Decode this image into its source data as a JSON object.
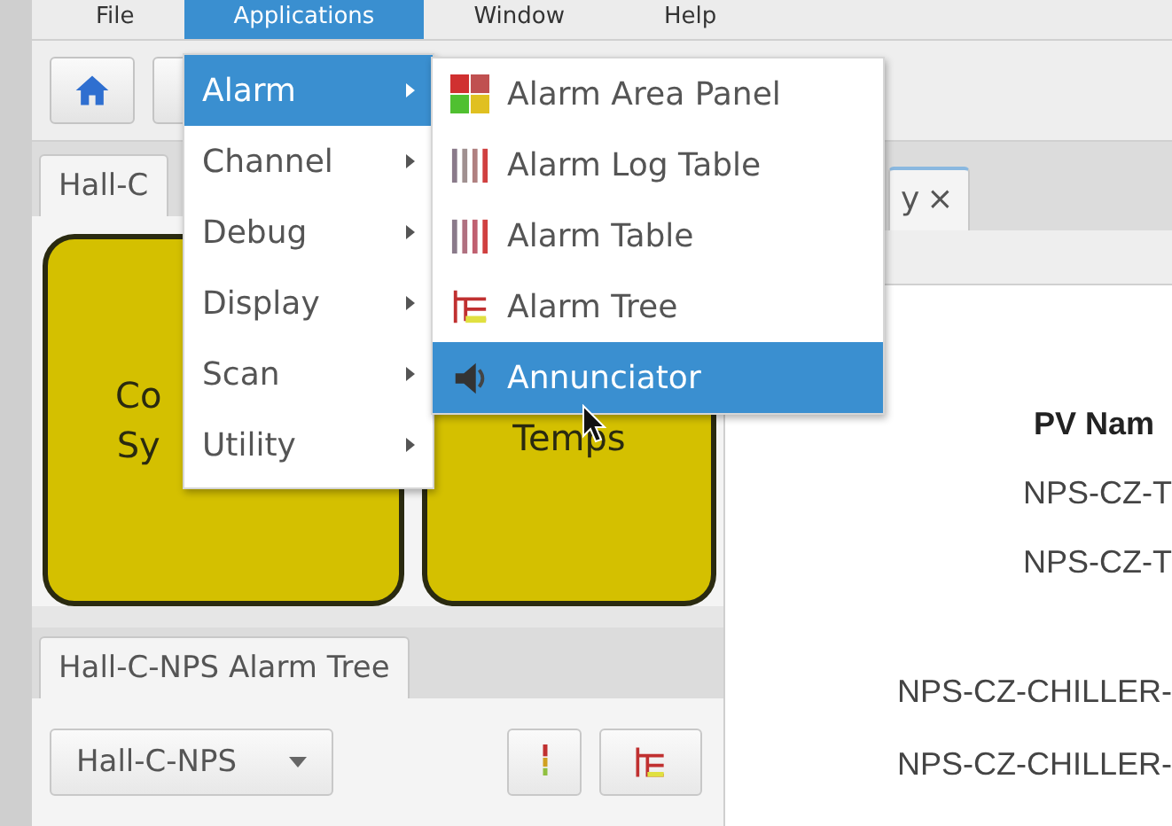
{
  "menubar": [
    {
      "label": "File",
      "selected": false
    },
    {
      "label": "Applications",
      "selected": true
    },
    {
      "label": "Window",
      "selected": false
    },
    {
      "label": "Help",
      "selected": false
    }
  ],
  "applications_menu": [
    {
      "label": "Alarm",
      "selected": true
    },
    {
      "label": "Channel",
      "selected": false
    },
    {
      "label": "Debug",
      "selected": false
    },
    {
      "label": "Display",
      "selected": false
    },
    {
      "label": "Scan",
      "selected": false
    },
    {
      "label": "Utility",
      "selected": false
    }
  ],
  "alarm_submenu": [
    {
      "label": "Alarm Area Panel",
      "kind": "area",
      "selected": false
    },
    {
      "label": "Alarm Log Table",
      "kind": "log",
      "selected": false
    },
    {
      "label": "Alarm Table",
      "kind": "table",
      "selected": false
    },
    {
      "label": "Alarm Tree",
      "kind": "tree",
      "selected": false
    },
    {
      "label": "Annunciator",
      "kind": "annunciator",
      "selected": true
    }
  ],
  "left_tab": {
    "label": "Hall-C"
  },
  "right_tab": {
    "label": "y",
    "close": "×"
  },
  "tiles": [
    {
      "lines": [
        "Co",
        "Sy"
      ]
    },
    {
      "lines": [
        "Temps"
      ]
    }
  ],
  "alarm_tree_tab": {
    "label": "Hall-C-NPS Alarm Tree"
  },
  "tree_selector": {
    "value": "Hall-C-NPS"
  },
  "table": {
    "header": "PV Nam",
    "rows": [
      "NPS-CZ-T",
      "NPS-CZ-T",
      "NPS-CZ-CHILLER-",
      "NPS-CZ-CHILLER-"
    ]
  }
}
